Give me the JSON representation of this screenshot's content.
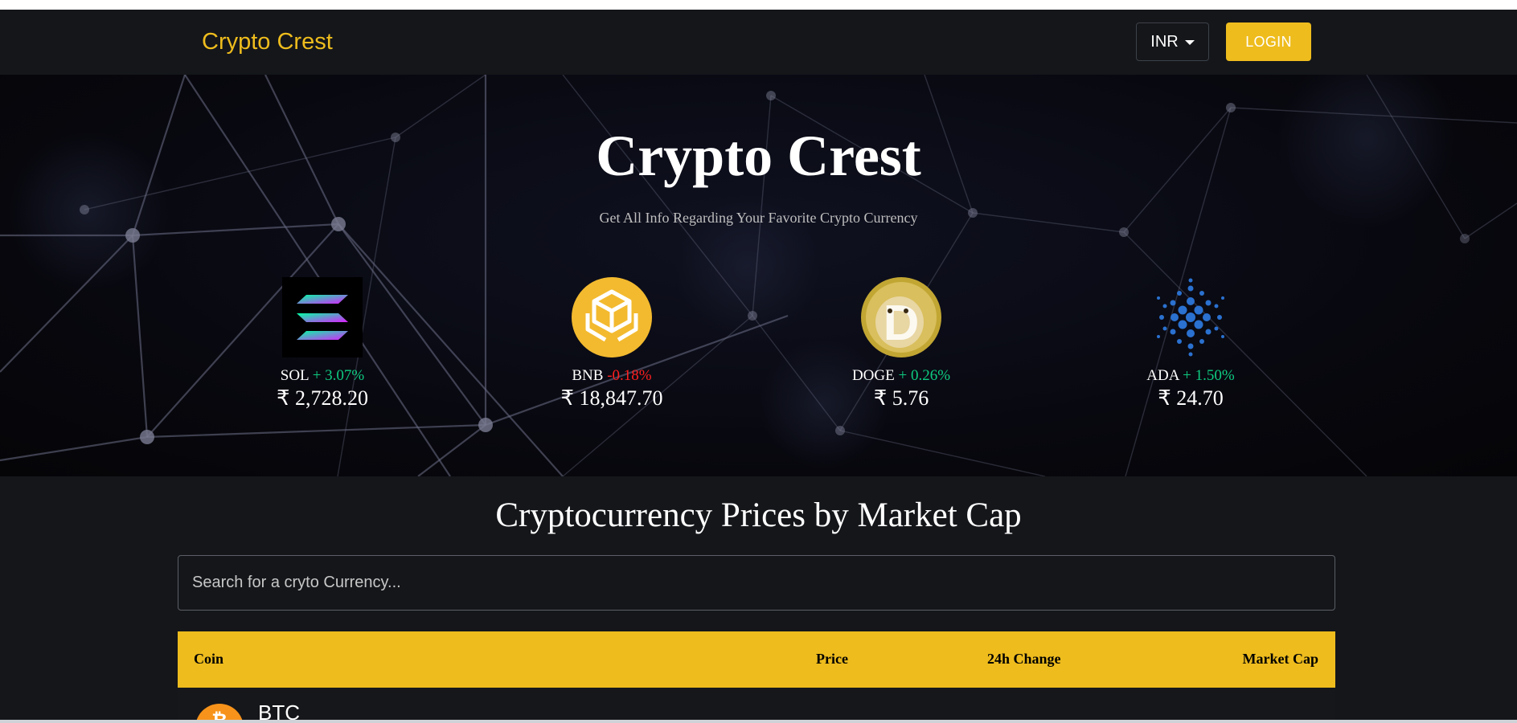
{
  "navbar": {
    "brand": "Crypto Crest",
    "currency": "INR",
    "login_label": "LOGIN"
  },
  "hero": {
    "title": "Crypto Crest",
    "subtitle": "Get All Info Regarding Your Favorite Crypto Currency",
    "trending": [
      {
        "symbol": "SOL",
        "change": "+ 3.07%",
        "direction": "up",
        "price": "₹ 2,728.20",
        "icon": "solana-logo-icon"
      },
      {
        "symbol": "BNB",
        "change": "-0.18%",
        "direction": "down",
        "price": "₹ 18,847.70",
        "icon": "bnb-logo-icon"
      },
      {
        "symbol": "DOGE",
        "change": "+ 0.26%",
        "direction": "up",
        "price": "₹ 5.76",
        "icon": "dogecoin-logo-icon"
      },
      {
        "symbol": "ADA",
        "change": "+ 1.50%",
        "direction": "up",
        "price": "₹ 24.70",
        "icon": "cardano-logo-icon"
      }
    ]
  },
  "market": {
    "title": "Cryptocurrency Prices by Market Cap",
    "search_placeholder": "Search for a cryto Currency...",
    "columns": [
      "Coin",
      "Price",
      "24h Change",
      "Market Cap"
    ],
    "rows": [
      {
        "symbol": "BTC",
        "icon": "bitcoin-logo-icon"
      }
    ]
  },
  "colors": {
    "accent": "#eebc1d",
    "background": "#14161a",
    "positive": "#0ecb81",
    "negative": "#ff1f1f"
  }
}
